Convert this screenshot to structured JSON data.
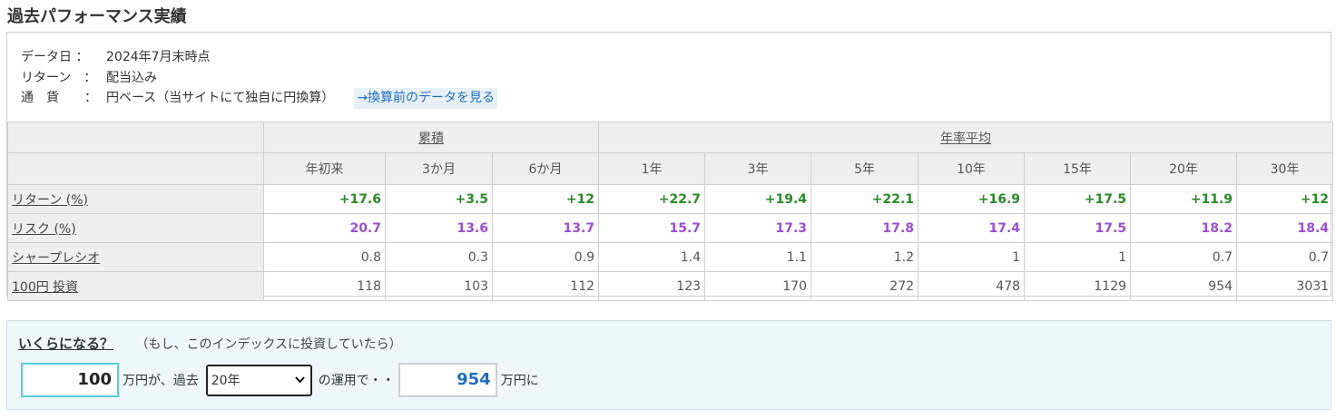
{
  "page_title": "過去パフォーマンス実績",
  "info": {
    "date_label": "データ日",
    "date_value": "2024年7月末時点",
    "return_label": "リターン",
    "return_value": "配当込み",
    "currency_label": "通貨",
    "currency_value": "円ベース（当サイトにて独自に円換算）",
    "link_text": "→換算前のデータを見る",
    "colon": "："
  },
  "table": {
    "group_cumulative": "累積",
    "group_annual": "年率平均",
    "columns": [
      "年初来",
      "3か月",
      "6か月",
      "1年",
      "3年",
      "5年",
      "10年",
      "15年",
      "20年",
      "30年"
    ],
    "rows": [
      {
        "label": "リターン (%)",
        "values": [
          "+17.6",
          "+3.5",
          "+12",
          "+22.7",
          "+19.4",
          "+22.1",
          "+16.9",
          "+17.5",
          "+11.9",
          "+12"
        ]
      },
      {
        "label": "リスク (%)",
        "values": [
          "20.7",
          "13.6",
          "13.7",
          "15.7",
          "17.3",
          "17.8",
          "17.4",
          "17.5",
          "18.2",
          "18.4"
        ]
      },
      {
        "label": "シャープレシオ",
        "values": [
          "0.8",
          "0.3",
          "0.9",
          "1.4",
          "1.1",
          "1.2",
          "1",
          "1",
          "0.7",
          "0.7"
        ]
      },
      {
        "label": "100円 投資",
        "values": [
          "118",
          "103",
          "112",
          "123",
          "170",
          "272",
          "478",
          "1129",
          "954",
          "3031"
        ]
      }
    ]
  },
  "calc": {
    "heading": "いくらになる？",
    "note": "（もし、このインデックスに投資していたら）",
    "amount": "100",
    "text1": "万円が、過去",
    "period": "20年",
    "text2": "の運用で・・",
    "result": "954",
    "text3": "万円に"
  },
  "colors": {
    "return": "#2a8a2a",
    "risk": "#9b4fd1",
    "link": "#1f6fbf"
  }
}
